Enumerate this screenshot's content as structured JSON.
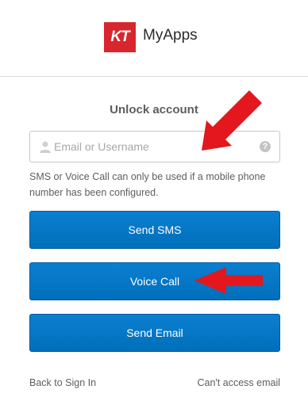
{
  "brand": {
    "badge": "KT",
    "name": "MyApps",
    "badge_color": "#d7262e"
  },
  "form": {
    "title": "Unlock account",
    "username_placeholder": "Email or Username",
    "username_value": "",
    "help_glyph": "?",
    "info_text": "SMS or Voice Call can only be used if a mobile phone number has been configured."
  },
  "buttons": {
    "send_sms": "Send SMS",
    "voice_call": "Voice Call",
    "send_email": "Send Email"
  },
  "links": {
    "back": "Back to Sign In",
    "cant_access": "Can't access email"
  },
  "colors": {
    "button": "#0077c8",
    "annotation_arrow": "#e3171d"
  },
  "icons": [
    "user-icon",
    "help-icon",
    "arrow-annotation"
  ]
}
